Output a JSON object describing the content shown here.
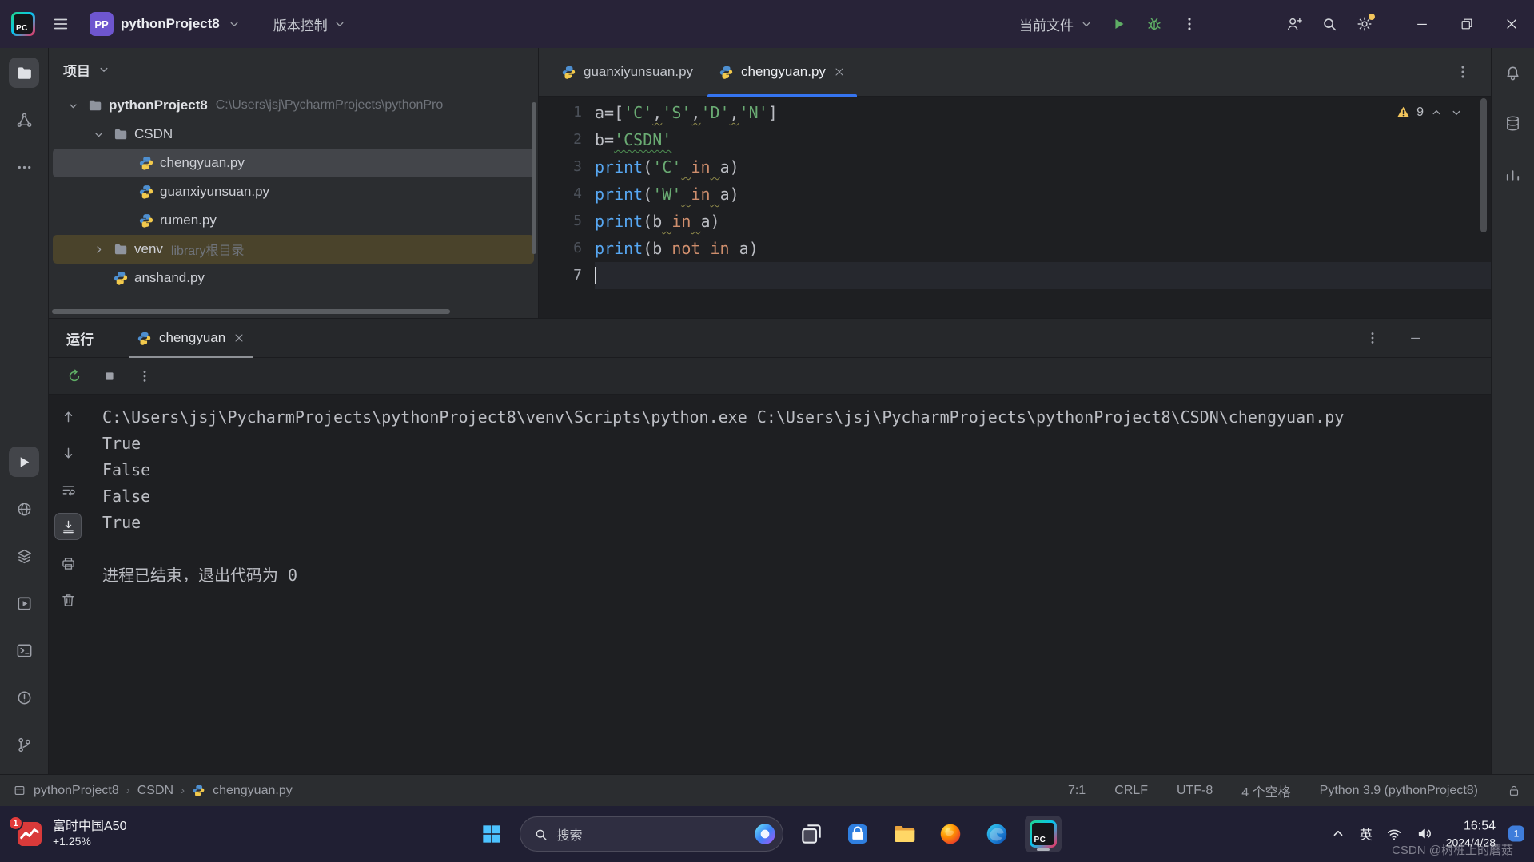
{
  "titlebar": {
    "project_name": "pythonProject8",
    "project_badge": "PP",
    "vcs_label": "版本控制",
    "current_file_label": "当前文件",
    "run_icons": [
      {
        "name": "run",
        "icon": "play",
        "color": "green"
      },
      {
        "name": "debug",
        "icon": "bug",
        "color": "green"
      },
      {
        "name": "more-actions",
        "icon": "ellipsis-v"
      }
    ],
    "right_icons": [
      {
        "name": "code-with-me",
        "icon": "user-plus"
      },
      {
        "name": "search-everywhere",
        "icon": "search"
      },
      {
        "name": "settings",
        "icon": "gear",
        "badge": true
      }
    ],
    "window_controls": [
      {
        "name": "minimize",
        "icon": "minimize"
      },
      {
        "name": "restore",
        "icon": "restore"
      },
      {
        "name": "close",
        "icon": "close"
      }
    ]
  },
  "left_strip": {
    "top": [
      {
        "name": "project",
        "icon": "folder",
        "active": true
      },
      {
        "name": "structure",
        "icon": "structure"
      },
      {
        "name": "more-tool-windows",
        "icon": "ellipsis-h"
      }
    ],
    "bottom": [
      {
        "name": "run",
        "icon": "play",
        "active": true
      },
      {
        "name": "python-console",
        "icon": "console"
      },
      {
        "name": "python-packages",
        "icon": "layers"
      },
      {
        "name": "services",
        "icon": "services"
      },
      {
        "name": "terminal",
        "icon": "terminal"
      },
      {
        "name": "problems",
        "icon": "problems"
      },
      {
        "name": "version-control",
        "icon": "branch"
      }
    ]
  },
  "right_strip": [
    {
      "name": "notifications",
      "icon": "bell"
    },
    {
      "name": "database",
      "icon": "database"
    },
    {
      "name": "profiler",
      "icon": "chart"
    }
  ],
  "project_panel": {
    "title": "项目",
    "tree": [
      {
        "depth": 0,
        "chevron": "down",
        "icon": "folder",
        "label": "pythonProject8",
        "detail": "C:\\Users\\jsj\\PycharmProjects\\pythonPro",
        "bold": true
      },
      {
        "depth": 1,
        "chevron": "down",
        "icon": "folder",
        "label": "CSDN"
      },
      {
        "depth": 2,
        "icon": "python",
        "label": "chengyuan.py",
        "selected": true
      },
      {
        "depth": 2,
        "icon": "python",
        "label": "guanxiyunsuan.py"
      },
      {
        "depth": 2,
        "icon": "python",
        "label": "rumen.py"
      },
      {
        "depth": 1,
        "chevron": "right",
        "icon": "folder",
        "label": "venv",
        "detail": "library根目录",
        "highlight": true
      },
      {
        "depth": 1,
        "icon": "python",
        "label": "anshand.py"
      }
    ]
  },
  "editor": {
    "tabs": [
      {
        "label": "guanxiyunsuan.py",
        "active": false
      },
      {
        "label": "chengyuan.py",
        "active": true,
        "closable": true
      }
    ],
    "warning_count": "9",
    "code": [
      {
        "no": "1",
        "tokens": [
          [
            "a=[",
            "d"
          ],
          [
            "'C'",
            "s"
          ],
          [
            ",",
            "d sqy"
          ],
          [
            "'S'",
            "s"
          ],
          [
            ",",
            "d sqy"
          ],
          [
            "'D'",
            "s"
          ],
          [
            ",",
            "d sqy"
          ],
          [
            "'N'",
            "s"
          ],
          [
            "]",
            "d"
          ]
        ]
      },
      {
        "no": "2",
        "tokens": [
          [
            "b=",
            "d"
          ],
          [
            "'CSDN'",
            "s sqg"
          ]
        ]
      },
      {
        "no": "3",
        "tokens": [
          [
            "print",
            "f"
          ],
          [
            "(",
            "d"
          ],
          [
            "'C'",
            "s"
          ],
          [
            " ",
            "d sqy"
          ],
          [
            "in",
            "k"
          ],
          [
            " ",
            "d sqy"
          ],
          [
            "a)",
            "d"
          ]
        ]
      },
      {
        "no": "4",
        "tokens": [
          [
            "print",
            "f"
          ],
          [
            "(",
            "d"
          ],
          [
            "'W'",
            "s"
          ],
          [
            " ",
            "d sqy"
          ],
          [
            "in",
            "k"
          ],
          [
            " ",
            "d sqy"
          ],
          [
            "a)",
            "d"
          ]
        ]
      },
      {
        "no": "5",
        "tokens": [
          [
            "print",
            "f"
          ],
          [
            "(b",
            "d"
          ],
          [
            " ",
            "d sqy"
          ],
          [
            "in",
            "k"
          ],
          [
            " ",
            "d sqy"
          ],
          [
            "a)",
            "d"
          ]
        ]
      },
      {
        "no": "6",
        "tokens": [
          [
            "print",
            "f"
          ],
          [
            "(b ",
            "d"
          ],
          [
            "not",
            "k"
          ],
          [
            " ",
            "d"
          ],
          [
            "in",
            "k"
          ],
          [
            " a)",
            "d"
          ]
        ]
      },
      {
        "no": "7",
        "tokens": [],
        "caret": true
      }
    ]
  },
  "run_panel": {
    "title": "运行",
    "tab_label": "chengyuan",
    "header_icons": [
      {
        "name": "more-options",
        "icon": "ellipsis-v"
      },
      {
        "name": "hide-panel",
        "icon": "minimize"
      }
    ],
    "toolbar_icons": [
      {
        "name": "rerun",
        "icon": "rerun",
        "color": "green"
      },
      {
        "name": "stop",
        "icon": "stop"
      },
      {
        "name": "more",
        "icon": "ellipsis-v"
      }
    ],
    "rail_icons": [
      {
        "name": "up-the-stack-trace",
        "icon": "arrow-up"
      },
      {
        "name": "down-the-stack-trace",
        "icon": "arrow-down"
      },
      {
        "name": "soft-wrap",
        "icon": "soft-wrap"
      },
      {
        "name": "scroll-to-end",
        "icon": "scroll-end",
        "active": true
      },
      {
        "name": "print",
        "icon": "printer"
      },
      {
        "name": "clear-all",
        "icon": "trash"
      }
    ],
    "output": [
      "C:\\Users\\jsj\\PycharmProjects\\pythonProject8\\venv\\Scripts\\python.exe C:\\Users\\jsj\\PycharmProjects\\pythonProject8\\CSDN\\chengyuan.py ",
      "True",
      "False",
      "False",
      "True",
      "",
      "进程已结束，退出代码为 0"
    ]
  },
  "status_bar": {
    "nav": [
      "pythonProject8",
      "CSDN",
      "chengyuan.py"
    ],
    "caret_position": "7:1",
    "line_separator": "CRLF",
    "encoding": "UTF-8",
    "indent": "4 个空格",
    "interpreter": "Python 3.9 (pythonProject8)"
  },
  "taskbar": {
    "widget": {
      "badge": "1",
      "title": "富时中国A50",
      "change": "+1.25%"
    },
    "search_label": "搜索",
    "apps": [
      {
        "name": "task-view",
        "icon": "task-view"
      },
      {
        "name": "store",
        "icon": "store"
      },
      {
        "name": "file-explorer",
        "icon": "explorer"
      },
      {
        "name": "firefox",
        "icon": "firefox"
      },
      {
        "name": "edge",
        "icon": "edge"
      },
      {
        "name": "pycharm",
        "icon": "pycharm",
        "active": true
      }
    ],
    "tray": {
      "ime": "英",
      "time": "16:54",
      "date": "2024/4/28",
      "badge": "1"
    }
  },
  "watermark": "CSDN @树桩上的蘑菇"
}
